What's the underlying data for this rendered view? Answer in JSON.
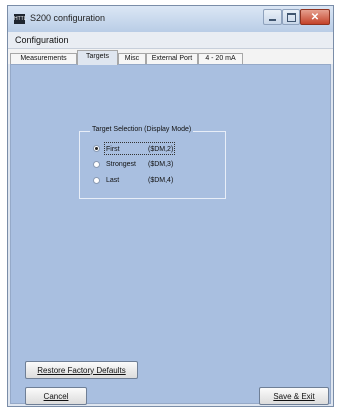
{
  "window": {
    "title": "S200 configuration",
    "app_icon_text": "HTTL",
    "close_glyph": "✕"
  },
  "menu": {
    "items": [
      "Configuration"
    ]
  },
  "tabs": [
    {
      "label": "Measurements",
      "active": false
    },
    {
      "label": "Targets",
      "active": true
    },
    {
      "label": "Misc",
      "active": false
    },
    {
      "label": "External Port",
      "active": false
    },
    {
      "label": "4 - 20 mA",
      "active": false
    }
  ],
  "target_selection": {
    "legend": "Target Selection (Display Mode)",
    "options": [
      {
        "label": "First",
        "code": "($DM,2)",
        "selected": true
      },
      {
        "label": "Strongest",
        "code": "($DM,3)",
        "selected": false
      },
      {
        "label": "Last",
        "code": "($DM,4)",
        "selected": false
      }
    ]
  },
  "buttons": {
    "restore": "Restore Factory Defaults",
    "cancel": "Cancel",
    "save": "Save & Exit"
  },
  "colors": {
    "panel_background": "#a9bfe0",
    "close_button": "#c4432a"
  }
}
